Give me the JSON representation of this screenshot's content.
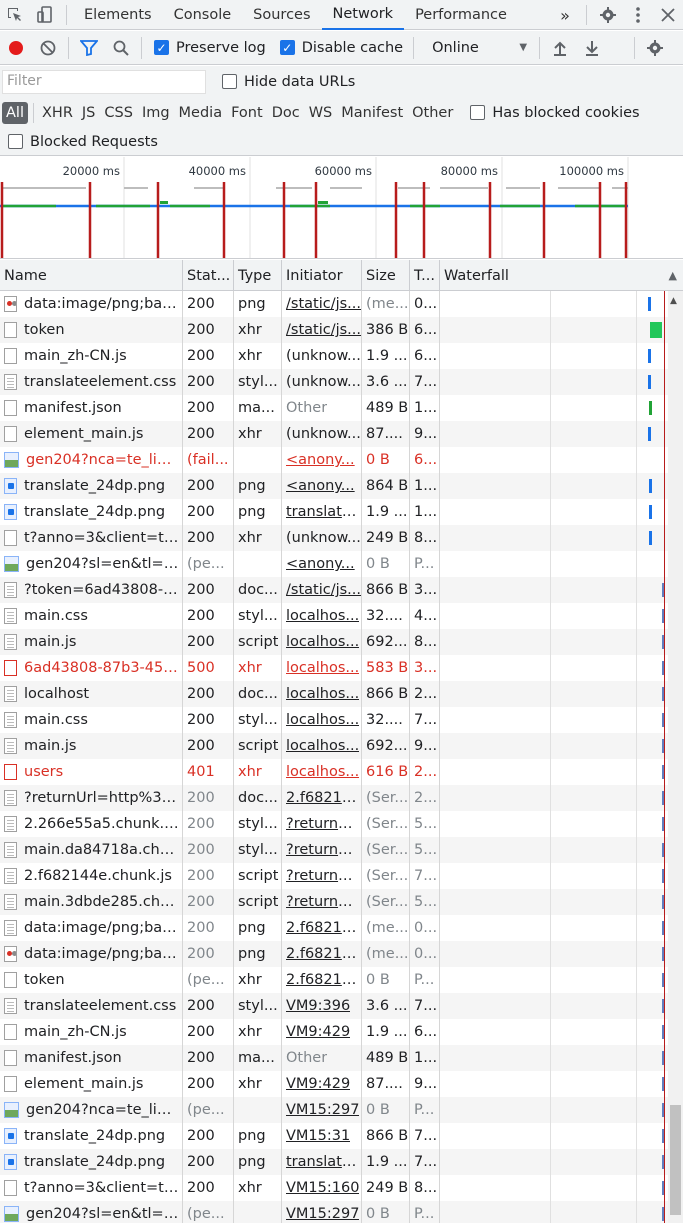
{
  "tabs": {
    "items": [
      "Elements",
      "Console",
      "Sources",
      "Network",
      "Performance"
    ],
    "active": "Network",
    "more": "»"
  },
  "toolbar": {
    "preserve_log": "Preserve log",
    "disable_cache": "Disable cache",
    "throttle": "Online"
  },
  "filter": {
    "placeholder": "Filter",
    "hide_data_urls": "Hide data URLs",
    "types": [
      "All",
      "XHR",
      "JS",
      "CSS",
      "Img",
      "Media",
      "Font",
      "Doc",
      "WS",
      "Manifest",
      "Other"
    ],
    "has_blocked_cookies": "Has blocked cookies",
    "blocked_requests": "Blocked Requests"
  },
  "overview": {
    "ticks": [
      "20000 ms",
      "40000 ms",
      "60000 ms",
      "80000 ms",
      "100000 ms"
    ]
  },
  "columns": {
    "name": "Name",
    "status": "Stat...",
    "type": "Type",
    "initiator": "Initiator",
    "size": "Size",
    "time": "T...",
    "waterfall": "Waterfall"
  },
  "rows": [
    {
      "name": "data:image/png;base...",
      "status": "200",
      "type": "png",
      "initiator": "/static/js...",
      "size": "(me...",
      "time": "0...",
      "icon": "imgdot",
      "link": true,
      "sizeDim": true
    },
    {
      "name": "token",
      "status": "200",
      "type": "xhr",
      "initiator": "/static/js...",
      "size": "386 B",
      "time": "6...",
      "icon": "blank",
      "link": true
    },
    {
      "name": "main_zh-CN.js",
      "status": "200",
      "type": "xhr",
      "initiator": "(unknow...",
      "size": "1.9 ...",
      "time": "6...",
      "icon": "blank"
    },
    {
      "name": "translateelement.css",
      "status": "200",
      "type": "styl...",
      "initiator": "(unknow...",
      "size": "3.6 ...",
      "time": "7...",
      "icon": "doc"
    },
    {
      "name": "manifest.json",
      "status": "200",
      "type": "ma...",
      "initiator": "Other",
      "size": "489 B",
      "time": "1...",
      "icon": "blank",
      "initDim": true
    },
    {
      "name": "element_main.js",
      "status": "200",
      "type": "xhr",
      "initiator": "(unknow...",
      "size": "87....",
      "time": "9...",
      "icon": "blank"
    },
    {
      "name": "gen204?nca=te_li&cl...",
      "status": "(fail...",
      "type": "",
      "initiator": "<anony...",
      "size": "0 B",
      "time": "6...",
      "icon": "img",
      "err": true,
      "link": true
    },
    {
      "name": "translate_24dp.png",
      "status": "200",
      "type": "png",
      "initiator": "<anony...",
      "size": "864 B",
      "time": "1...",
      "icon": "png",
      "link": true
    },
    {
      "name": "translate_24dp.png",
      "status": "200",
      "type": "png",
      "initiator": "translate...",
      "size": "1.9 ...",
      "time": "1...",
      "icon": "png",
      "link": true
    },
    {
      "name": "t?anno=3&client=te...",
      "status": "200",
      "type": "xhr",
      "initiator": "(unknow...",
      "size": "249 B",
      "time": "8...",
      "icon": "blank"
    },
    {
      "name": "gen204?sl=en&tl=zh...",
      "status": "(pe...",
      "type": "",
      "initiator": "<anony...",
      "size": "0 B",
      "time": "P...",
      "icon": "img",
      "link": true,
      "dim": true
    },
    {
      "name": "?token=6ad43808-8...",
      "status": "200",
      "type": "doc...",
      "initiator": "/static/js...",
      "size": "866 B",
      "time": "3...",
      "icon": "doc",
      "link": true
    },
    {
      "name": "main.css",
      "status": "200",
      "type": "styl...",
      "initiator": "localhos...",
      "size": "32....",
      "time": "4...",
      "icon": "doc",
      "link": true
    },
    {
      "name": "main.js",
      "status": "200",
      "type": "script",
      "initiator": "localhos...",
      "size": "692...",
      "time": "8...",
      "icon": "doc",
      "link": true
    },
    {
      "name": "6ad43808-87b3-453f...",
      "status": "500",
      "type": "xhr",
      "initiator": "localhos...",
      "size": "583 B",
      "time": "3...",
      "icon": "red",
      "err": true,
      "link": true
    },
    {
      "name": "localhost",
      "status": "200",
      "type": "doc...",
      "initiator": "localhos...",
      "size": "866 B",
      "time": "2...",
      "icon": "doc",
      "link": true
    },
    {
      "name": "main.css",
      "status": "200",
      "type": "styl...",
      "initiator": "localhos...",
      "size": "32....",
      "time": "7...",
      "icon": "doc",
      "link": true
    },
    {
      "name": "main.js",
      "status": "200",
      "type": "script",
      "initiator": "localhos...",
      "size": "692...",
      "time": "9...",
      "icon": "doc",
      "link": true
    },
    {
      "name": "users",
      "status": "401",
      "type": "xhr",
      "initiator": "localhos...",
      "size": "616 B",
      "time": "2...",
      "icon": "red",
      "err": true,
      "link": true
    },
    {
      "name": "?returnUrl=http%3A...",
      "status": "200",
      "type": "doc...",
      "initiator": "2.f68214...",
      "size": "(Ser...",
      "time": "2...",
      "icon": "doc",
      "link": true,
      "dim": true
    },
    {
      "name": "2.266e55a5.chunk.css",
      "status": "200",
      "type": "styl...",
      "initiator": "?returnU...",
      "size": "(Ser...",
      "time": "5...",
      "icon": "doc",
      "link": true,
      "dim": true
    },
    {
      "name": "main.da84718a.chun...",
      "status": "200",
      "type": "styl...",
      "initiator": "?returnU...",
      "size": "(Ser...",
      "time": "5...",
      "icon": "doc",
      "link": true,
      "dim": true
    },
    {
      "name": "2.f682144e.chunk.js",
      "status": "200",
      "type": "script",
      "initiator": "?returnU...",
      "size": "(Ser...",
      "time": "7...",
      "icon": "doc",
      "link": true,
      "dim": true
    },
    {
      "name": "main.3dbde285.chun...",
      "status": "200",
      "type": "script",
      "initiator": "?returnU...",
      "size": "(Ser...",
      "time": "5...",
      "icon": "doc",
      "link": true,
      "dim": true
    },
    {
      "name": "data:image/png;base...",
      "status": "200",
      "type": "png",
      "initiator": "2.f68214...",
      "size": "(me...",
      "time": "0...",
      "icon": "doc",
      "link": true,
      "dim": true
    },
    {
      "name": "data:image/png;base...",
      "status": "200",
      "type": "png",
      "initiator": "2.f68214...",
      "size": "(me...",
      "time": "0...",
      "icon": "imgdot",
      "link": true,
      "dim": true
    },
    {
      "name": "token",
      "status": "(pe...",
      "type": "xhr",
      "initiator": "2.f68214...",
      "size": "0 B",
      "time": "P...",
      "icon": "blank",
      "link": true,
      "dim": true
    },
    {
      "name": "translateelement.css",
      "status": "200",
      "type": "styl...",
      "initiator": "VM9:396",
      "size": "3.6 ...",
      "time": "7...",
      "icon": "doc",
      "link": true
    },
    {
      "name": "main_zh-CN.js",
      "status": "200",
      "type": "xhr",
      "initiator": "VM9:429",
      "size": "1.9 ...",
      "time": "6...",
      "icon": "blank",
      "link": true
    },
    {
      "name": "manifest.json",
      "status": "200",
      "type": "ma...",
      "initiator": "Other",
      "size": "489 B",
      "time": "1...",
      "icon": "blank",
      "initDim": true
    },
    {
      "name": "element_main.js",
      "status": "200",
      "type": "xhr",
      "initiator": "VM9:429",
      "size": "87....",
      "time": "9...",
      "icon": "blank",
      "link": true
    },
    {
      "name": "gen204?nca=te_li&cl...",
      "status": "(pe...",
      "type": "",
      "initiator": "VM15:297",
      "size": "0 B",
      "time": "P...",
      "icon": "img",
      "link": true,
      "dim": true
    },
    {
      "name": "translate_24dp.png",
      "status": "200",
      "type": "png",
      "initiator": "VM15:31",
      "size": "866 B",
      "time": "7...",
      "icon": "png",
      "link": true
    },
    {
      "name": "translate_24dp.png",
      "status": "200",
      "type": "png",
      "initiator": "translate...",
      "size": "1.9 ...",
      "time": "7...",
      "icon": "png",
      "link": true
    },
    {
      "name": "t?anno=3&client=te...",
      "status": "200",
      "type": "xhr",
      "initiator": "VM15:160",
      "size": "249 B",
      "time": "8...",
      "icon": "blank",
      "link": true
    },
    {
      "name": "gen204?sl=en&tl=zh...",
      "status": "(pe...",
      "type": "",
      "initiator": "VM15:297",
      "size": "0 B",
      "time": "P...",
      "icon": "img",
      "link": true,
      "dim": true
    }
  ],
  "colors": {
    "accent": "#1a73e8",
    "error": "#d93025",
    "marker": "#b71c1c",
    "record": "#e41b1b"
  }
}
